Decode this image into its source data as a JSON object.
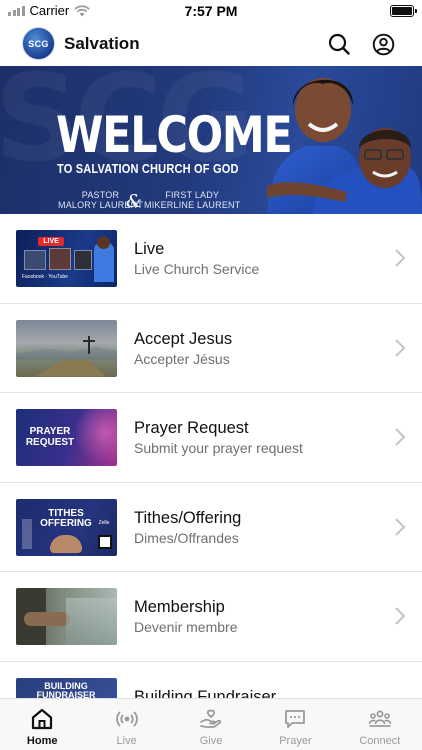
{
  "status_bar": {
    "carrier": "Carrier",
    "time": "7:57 PM"
  },
  "header": {
    "logo_text": "SCG",
    "title": "Salvation"
  },
  "hero": {
    "bg_letters": "SCG",
    "welcome": "WELCOME",
    "subtitle": "TO SALVATION CHURCH OF GOD",
    "pastor_role": "PASTOR",
    "pastor_name": "MALORY LAURENT",
    "lady_role": "FIRST LADY",
    "lady_name": "MIKERLINE LAURENT",
    "amp": "&"
  },
  "list": [
    {
      "title": "Live",
      "subtitle": "Live Church Service",
      "thumb_text": "LIVE",
      "thumb_caption": "Facebook · YouTube"
    },
    {
      "title": "Accept Jesus",
      "subtitle": "Accepter Jésus",
      "thumb_text": "",
      "thumb_caption": ""
    },
    {
      "title": "Prayer Request",
      "subtitle": "Submit your prayer request",
      "thumb_text": "PRAYER REQUEST",
      "thumb_caption": ""
    },
    {
      "title": "Tithes/Offering",
      "subtitle": "Dimes/Offrandes",
      "thumb_text": "TITHES OFFERING",
      "thumb_caption": "Zelle"
    },
    {
      "title": "Membership",
      "subtitle": "Devenir membre",
      "thumb_text": "",
      "thumb_caption": ""
    },
    {
      "title": "Building Fundraiser",
      "subtitle": "",
      "thumb_text": "BUILDING FUNDRAISER",
      "thumb_caption": ""
    }
  ],
  "tabs": [
    {
      "label": "Home",
      "icon": "home-icon",
      "active": true
    },
    {
      "label": "Live",
      "icon": "broadcast-icon",
      "active": false
    },
    {
      "label": "Give",
      "icon": "give-hand-heart-icon",
      "active": false
    },
    {
      "label": "Prayer",
      "icon": "chat-bubble-icon",
      "active": false
    },
    {
      "label": "Connect",
      "icon": "people-group-icon",
      "active": false
    }
  ],
  "colors": {
    "accent": "#1f3a80",
    "inactive_tab": "#9a9a9a",
    "divider": "#e4e4e4"
  }
}
